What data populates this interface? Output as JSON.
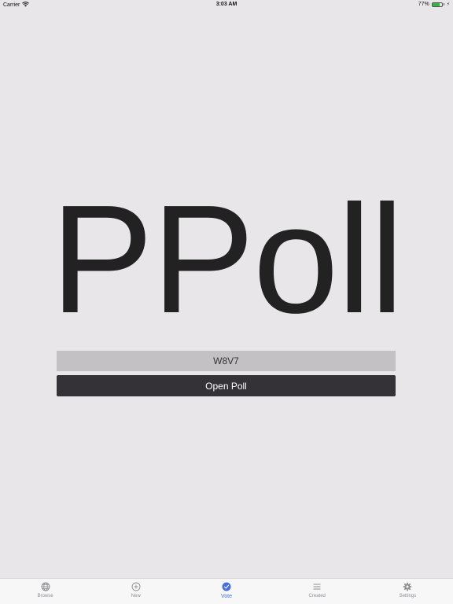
{
  "status_bar": {
    "carrier": "Carrier",
    "time": "3:03 AM",
    "battery_percent": "77%",
    "battery_level": 0.77,
    "battery_color": "#3bb143"
  },
  "main": {
    "title": "PPoll",
    "code_value": "W8V7",
    "open_button_label": "Open Poll"
  },
  "tab_bar": {
    "active_color": "#4a6ee0",
    "tabs": [
      {
        "label": "Browse",
        "icon": "globe-icon"
      },
      {
        "label": "New",
        "icon": "plus-circle-icon"
      },
      {
        "label": "Vote",
        "icon": "checkmark-circle-icon"
      },
      {
        "label": "Created",
        "icon": "list-icon"
      },
      {
        "label": "Settings",
        "icon": "gear-icon"
      }
    ],
    "active_tab": "Vote"
  }
}
